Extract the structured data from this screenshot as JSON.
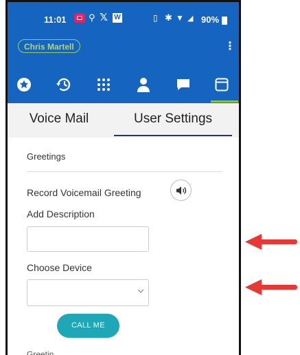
{
  "status_bar": {
    "time": "11:01",
    "battery": "90%",
    "w_icon": "W",
    "x_icon": "𝕏"
  },
  "header": {
    "user_name": "Chris Martell",
    "menu_icon": "kebab-menu-icon"
  },
  "nav_icons": [
    "star-icon",
    "history-icon",
    "dialpad-icon",
    "person-icon",
    "chat-icon",
    "window-icon"
  ],
  "tabs": [
    {
      "label": "Voice Mail",
      "active": false
    },
    {
      "label": "User Settings",
      "active": true
    }
  ],
  "settings": {
    "section_title": "Greetings",
    "record_label": "Record Voicemail Greeting",
    "add_description_label": "Add Description",
    "add_description_value": "",
    "choose_device_label": "Choose Device",
    "choose_device_value": "",
    "call_me_button": "CALL ME",
    "next_section_cut": "Greetin"
  },
  "colors": {
    "header_blue": "#1565c0",
    "accent_green": "#8bc34a",
    "call_button": "#1fa7b8",
    "arrow_red": "#e53935"
  }
}
